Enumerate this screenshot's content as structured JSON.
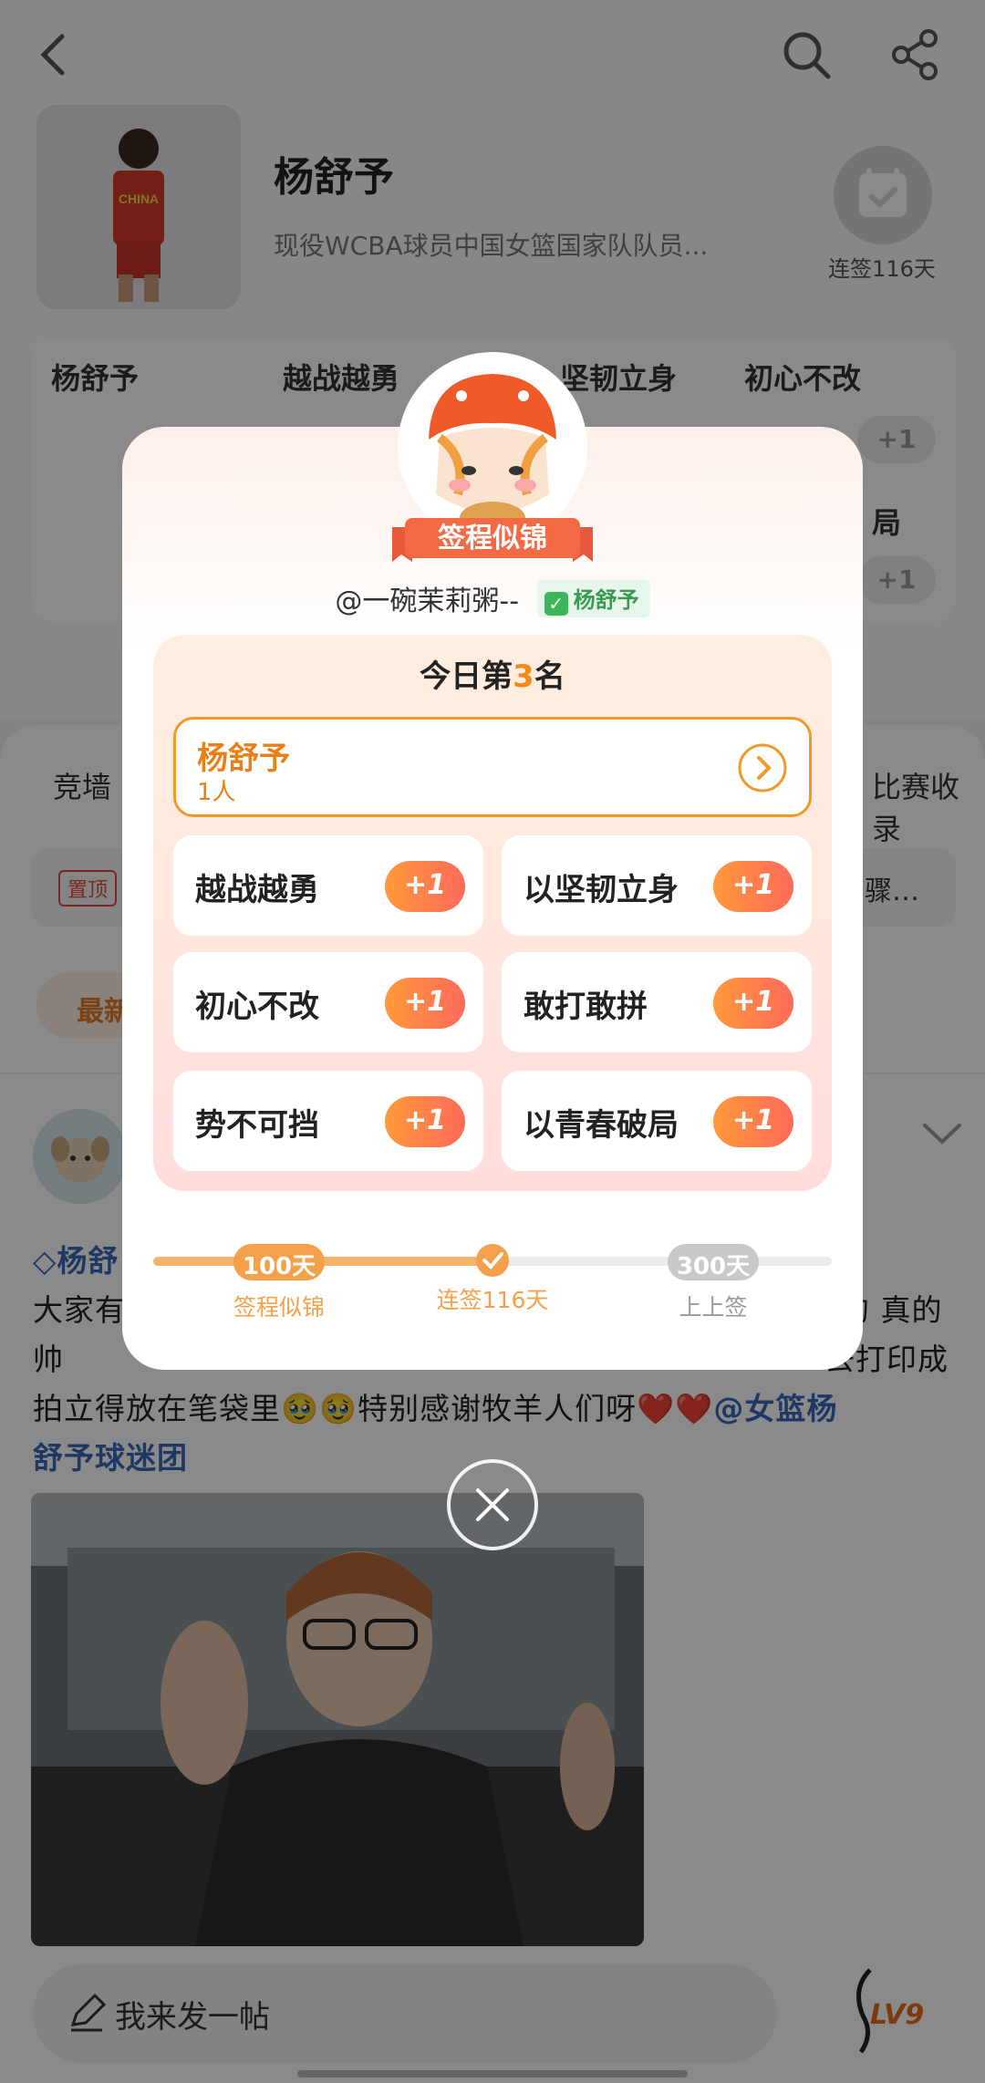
{
  "header": {
    "title": "杨舒予",
    "subtitle": "现役WCBA球员中国女篮国家队队员...",
    "checkin_status": "连签116天"
  },
  "hot_grid": {
    "cells": [
      "杨舒予",
      "越战越勇",
      "坚韧立身",
      "初心不改"
    ],
    "plus_label": "+1",
    "partial_label": "局"
  },
  "content": {
    "tabs": [
      "竞墙",
      "比赛收录"
    ],
    "pinned_badge": "置顶",
    "pinned_text": "骤…",
    "sort_chip": "最新",
    "post": {
      "author_partial": "杨舒",
      "line1_left": "大家有",
      "line1_right": "的 真的",
      "line2_left": "帅",
      "line2_right": "去打印成",
      "line3": "拍立得放在笔袋里🥹🥹特别感谢牧羊人们呀❤️❤️",
      "mention": "@女篮杨",
      "line4": "舒予球迷团"
    }
  },
  "bottom_bar": {
    "compose_placeholder": "我来发一帖",
    "level_badge": "LV9"
  },
  "modal": {
    "badge_title": "签程似锦",
    "username": "@一碗茉莉粥--",
    "team_tag": "杨舒予",
    "rank_prefix": "今日第",
    "rank_number": "3",
    "rank_suffix": "名",
    "main_card": {
      "title": "杨舒予",
      "count": "1人"
    },
    "cheer_buttons": [
      {
        "label": "越战越勇",
        "plus": "+1"
      },
      {
        "label": "以坚韧立身",
        "plus": "+1"
      },
      {
        "label": "初心不改",
        "plus": "+1"
      },
      {
        "label": "敢打敢拼",
        "plus": "+1"
      },
      {
        "label": "势不可挡",
        "plus": "+1"
      },
      {
        "label": "以青春破局",
        "plus": "+1"
      }
    ],
    "progress": {
      "milestones": [
        {
          "value": "100天",
          "label": "签程似锦",
          "state": "done"
        },
        {
          "value": "",
          "label": "连签116天",
          "state": "current"
        },
        {
          "value": "300天",
          "label": "上上签",
          "state": "upcoming"
        }
      ],
      "accent_color": "#f5a04a",
      "inactive_color": "#c9c9c9"
    }
  },
  "colors": {
    "accent": "#f08a1a",
    "plus_gradient_start": "#ff9a3c",
    "plus_gradient_end": "#ff6a5a",
    "link": "#3a66b8"
  }
}
